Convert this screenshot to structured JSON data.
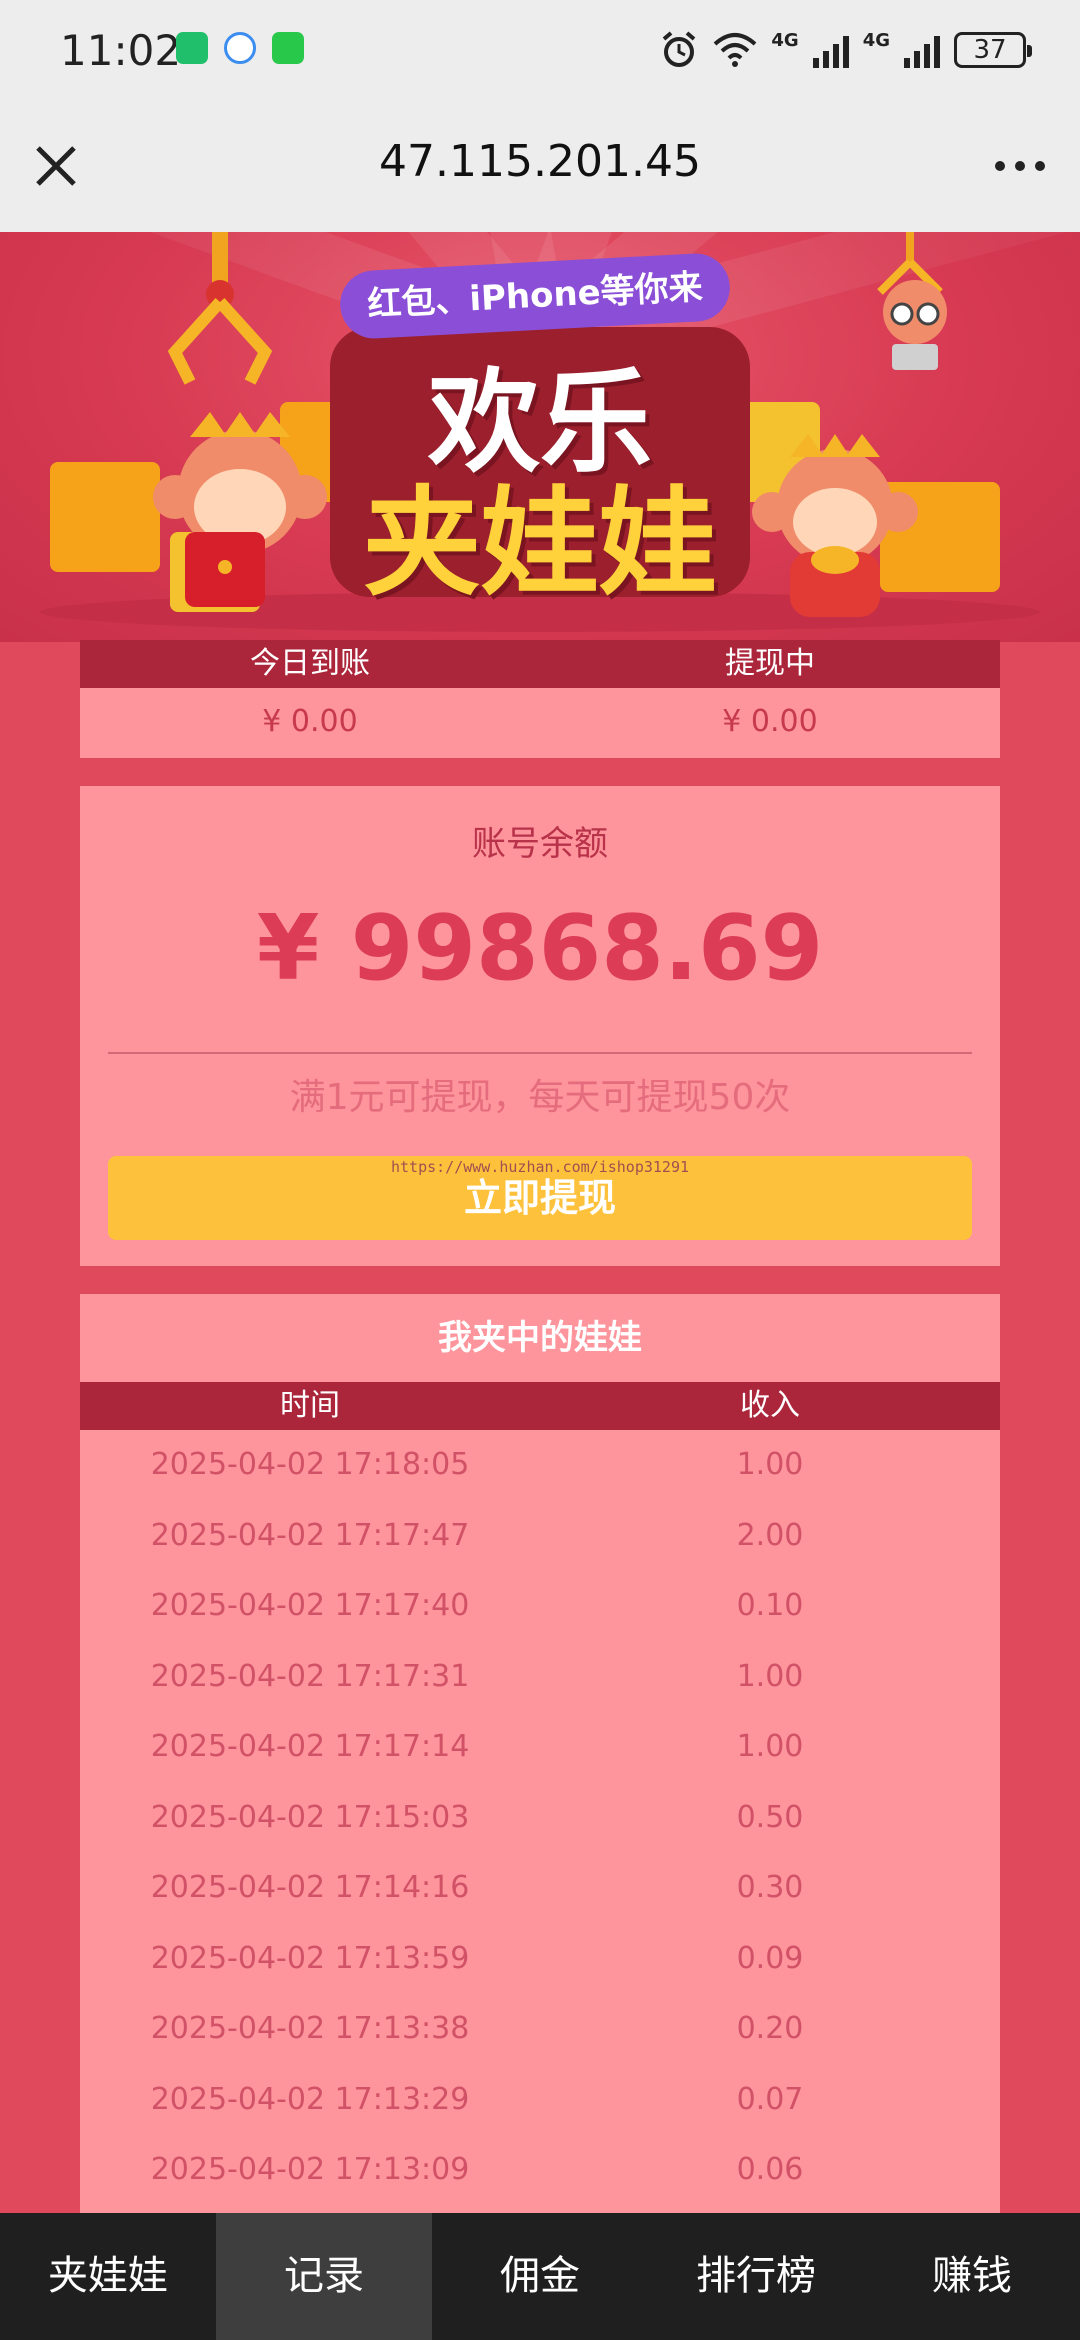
{
  "status_bar": {
    "time": "11:02",
    "network_1": "4G",
    "network_2": "4G",
    "battery": "37"
  },
  "browser": {
    "url": "47.115.201.45",
    "close_icon": "close-icon",
    "more_icon": "more-icon"
  },
  "banner": {
    "tagline": "红包、iPhone等你来",
    "title_line1": "欢乐",
    "title_line2": "夹娃娃"
  },
  "stats": {
    "today_label": "今日到账",
    "pending_label": "提现中",
    "today_value": "¥ 0.00",
    "pending_value": "¥ 0.00"
  },
  "balance": {
    "label": "账号余额",
    "value": "¥ 99868.69",
    "hint": "满1元可提现，每天可提现50次",
    "withdraw_label": "立即提现",
    "watermark": "https://www.huzhan.com/ishop31291"
  },
  "records": {
    "title": "我夹中的娃娃",
    "col_time": "时间",
    "col_income": "收入",
    "rows": [
      {
        "time": "2025-04-02 17:18:05",
        "amount": "1.00"
      },
      {
        "time": "2025-04-02 17:17:47",
        "amount": "2.00"
      },
      {
        "time": "2025-04-02 17:17:40",
        "amount": "0.10"
      },
      {
        "time": "2025-04-02 17:17:31",
        "amount": "1.00"
      },
      {
        "time": "2025-04-02 17:17:14",
        "amount": "1.00"
      },
      {
        "time": "2025-04-02 17:15:03",
        "amount": "0.50"
      },
      {
        "time": "2025-04-02 17:14:16",
        "amount": "0.30"
      },
      {
        "time": "2025-04-02 17:13:59",
        "amount": "0.09"
      },
      {
        "time": "2025-04-02 17:13:38",
        "amount": "0.20"
      },
      {
        "time": "2025-04-02 17:13:29",
        "amount": "0.07"
      },
      {
        "time": "2025-04-02 17:13:09",
        "amount": "0.06"
      }
    ]
  },
  "nav": {
    "items": [
      "夹娃娃",
      "记录",
      "佣金",
      "排行榜",
      "赚钱"
    ],
    "active_index": 1
  },
  "colors": {
    "page_bg": "#e0485b",
    "card_bg": "#fe949c",
    "header_bar": "#ab263a",
    "button_yellow": "#fec13c",
    "nav_bg": "#1f1f1f"
  }
}
